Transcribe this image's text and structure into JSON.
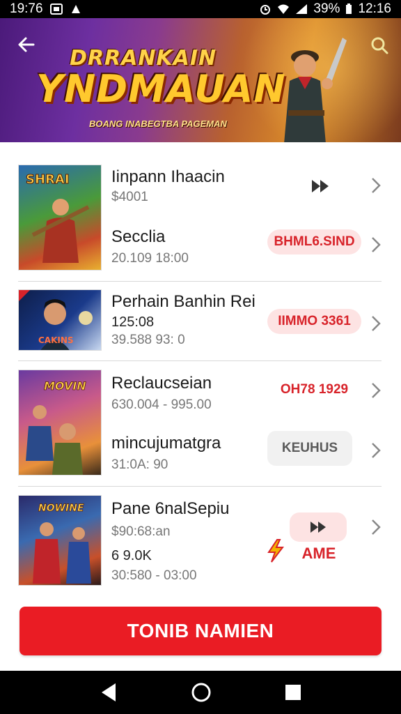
{
  "status_bar": {
    "time": "19:76",
    "battery": "39%",
    "clock_right": "12:16"
  },
  "banner": {
    "title_top": "DRRANKAIN",
    "title_main": "YNDMAUAN",
    "subtitle": "BOANG INABEGTBA PAGEMAN"
  },
  "items": [
    {
      "title": "Iinpann Ihaacin",
      "sub": "$4001"
    },
    {
      "title": "Secclia",
      "sub": "20.109 18:00",
      "badge": "BHML6.SIND"
    },
    {
      "title": "Perhain Banhin Rei",
      "sub_dark": "125:08",
      "sub": "39.588 93: 0",
      "badge": "IIMMO 3361",
      "thumb_label": "CAKINS"
    },
    {
      "title": "Reclaucseian",
      "sub": "630.004 - 995.00",
      "badge": "OH78 1929"
    },
    {
      "title": "mincujumatgra",
      "sub": "31:0A: 90",
      "badge": "KEUHUS"
    },
    {
      "title": "Pane 6nalSepiu",
      "sub": "$90:68:an",
      "sub_dark": "6 9.0K",
      "sub2": "30:580 - 03:00",
      "badge": "AME"
    }
  ],
  "thumbs": {
    "t1": "SHRAI",
    "t3": "MOVIN",
    "t4": "NOWINE"
  },
  "cta": {
    "label": "TONIB NAMIEN"
  },
  "colors": {
    "accent": "#ea1c24",
    "badge_bg": "#fde3e3"
  }
}
